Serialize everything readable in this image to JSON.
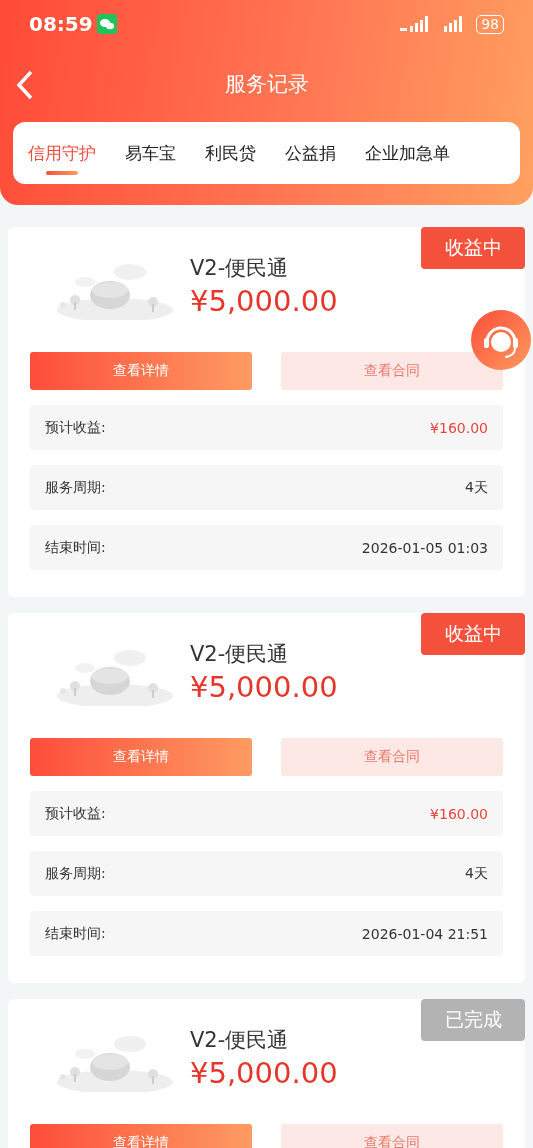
{
  "status_bar": {
    "time": "08:59",
    "battery": "98"
  },
  "header": {
    "title": "服务记录"
  },
  "tabs": [
    {
      "label": "信用守护",
      "selected": true
    },
    {
      "label": "易车宝",
      "selected": false
    },
    {
      "label": "利民贷",
      "selected": false
    },
    {
      "label": "公益捐",
      "selected": false
    },
    {
      "label": "企业加急单",
      "selected": false
    }
  ],
  "records": [
    {
      "status": {
        "label": "收益中",
        "kind": "active"
      },
      "name": "V2-便民通",
      "amount": "¥5,000.00",
      "buttons": [
        "查看详情",
        "查看合同"
      ],
      "fields": [
        {
          "label": "预计收益:",
          "value": "¥160.00",
          "kind": "money"
        },
        {
          "label": "服务周期:",
          "value": "4天",
          "kind": "plain"
        },
        {
          "label": "结束时间:",
          "value": "2026-01-05 01:03",
          "kind": "plain"
        }
      ]
    },
    {
      "status": {
        "label": "收益中",
        "kind": "active"
      },
      "name": "V2-便民通",
      "amount": "¥5,000.00",
      "buttons": [
        "查看详情",
        "查看合同"
      ],
      "fields": [
        {
          "label": "预计收益:",
          "value": "¥160.00",
          "kind": "money"
        },
        {
          "label": "服务周期:",
          "value": "4天",
          "kind": "plain"
        },
        {
          "label": "结束时间:",
          "value": "2026-01-04 21:51",
          "kind": "plain"
        }
      ]
    },
    {
      "status": {
        "label": "已完成",
        "kind": "done"
      },
      "name": "V2-便民通",
      "amount": "¥5,000.00",
      "buttons": [
        "查看详情",
        "查看合同"
      ]
    }
  ]
}
